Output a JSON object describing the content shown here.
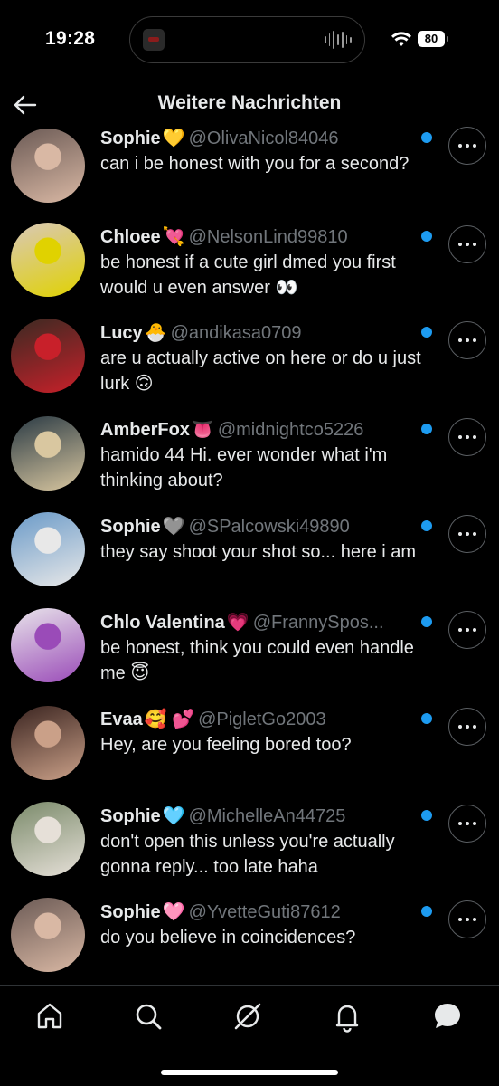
{
  "status_bar": {
    "time": "19:28",
    "battery": "80"
  },
  "header": {
    "title": "Weitere Nachrichten"
  },
  "messages": [
    {
      "name": "Sophie",
      "emoji": "💛",
      "handle": "@OlivaNicol84046",
      "preview": "can i be honest with you for a second?",
      "avatar": [
        "#6b5a55",
        "#d9b8a4"
      ]
    },
    {
      "name": "Chloee",
      "emoji": "💘",
      "handle": "@NelsonLind99810",
      "preview": "be honest if a cute girl dmed you first would u even answer 👀",
      "avatar": [
        "#d9c8b8",
        "#e0d200"
      ]
    },
    {
      "name": "Lucy",
      "emoji": "🐣",
      "handle": "@andikasa0709",
      "preview": "are u actually active on here or do u just lurk 🙃",
      "avatar": [
        "#3a2a22",
        "#c8202a"
      ]
    },
    {
      "name": "AmberFox",
      "emoji": "👅",
      "handle": "@midnightco5226",
      "preview": "hamido 44 Hi. ever wonder what i'm thinking about?",
      "avatar": [
        "#2a3a44",
        "#d9c7a0"
      ]
    },
    {
      "name": "Sophie",
      "emoji": "🩶",
      "handle": "@SPalcowski49890",
      "preview": "they say shoot your shot so... here i am",
      "avatar": [
        "#6a9ac8",
        "#e8e8e8"
      ]
    },
    {
      "name": "Chlo Valentina",
      "emoji": "💗",
      "handle": "@FrannySpos...",
      "preview": "be honest, think you could even handle me 😇",
      "avatar": [
        "#e8e4ea",
        "#9a4bb8"
      ]
    },
    {
      "name": "Evaa",
      "emoji": "🥰 💕",
      "handle": "@PigletGo2003",
      "preview": "Hey, are you feeling bored too?",
      "avatar": [
        "#3a2420",
        "#caa088"
      ]
    },
    {
      "name": "Sophie",
      "emoji": "🩵",
      "handle": "@MichelleAn44725",
      "preview": "don't open this unless you're actually gonna reply... too late haha",
      "avatar": [
        "#7a8a6a",
        "#e6e0d8"
      ]
    },
    {
      "name": "Sophie",
      "emoji": "🩷",
      "handle": "@YvetteGuti87612",
      "preview": "do you believe in coincidences?",
      "avatar": [
        "#6b5a55",
        "#d9b8a4"
      ]
    }
  ]
}
